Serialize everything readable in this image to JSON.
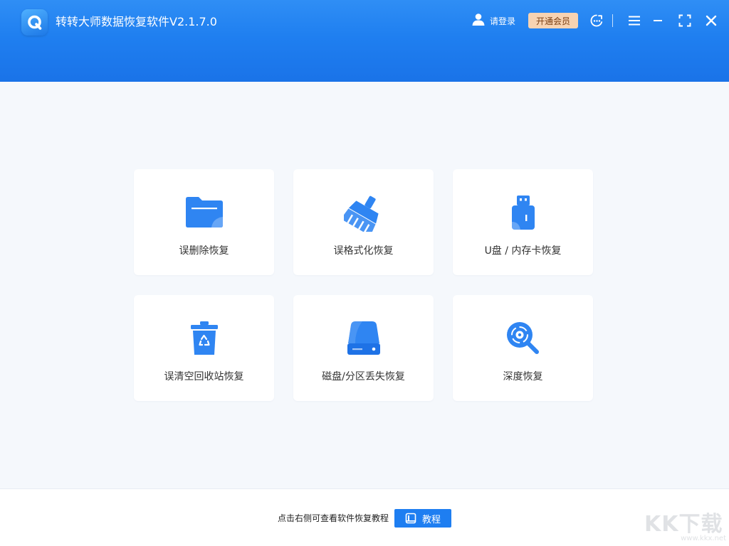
{
  "app": {
    "title": "转转大师数据恢复软件V2.1.7.0",
    "logo_icon": "app-logo-q-icon"
  },
  "header": {
    "login_label": "请登录",
    "vip_label": "开通会员",
    "icons": [
      "user-icon",
      "support-icon",
      "menu-icon",
      "minimize-icon",
      "maximize-icon",
      "close-icon"
    ],
    "accent_color": "#1f7ff0"
  },
  "cards": [
    {
      "label": "误删除恢复",
      "icon": "folder-icon"
    },
    {
      "label": "误格式化恢复",
      "icon": "broom-icon"
    },
    {
      "label": "U盘 / 内存卡恢复",
      "icon": "usb-drive-icon"
    },
    {
      "label": "误清空回收站恢复",
      "icon": "recycle-bin-icon"
    },
    {
      "label": "磁盘/分区丢失恢复",
      "icon": "hard-disk-icon"
    },
    {
      "label": "深度恢复",
      "icon": "deep-scan-icon"
    }
  ],
  "footer": {
    "hint": "点击右侧可查看软件恢复教程",
    "tutorial_label": "教程"
  },
  "watermark": {
    "text": "KK下载",
    "url": "www.kkx.net"
  }
}
